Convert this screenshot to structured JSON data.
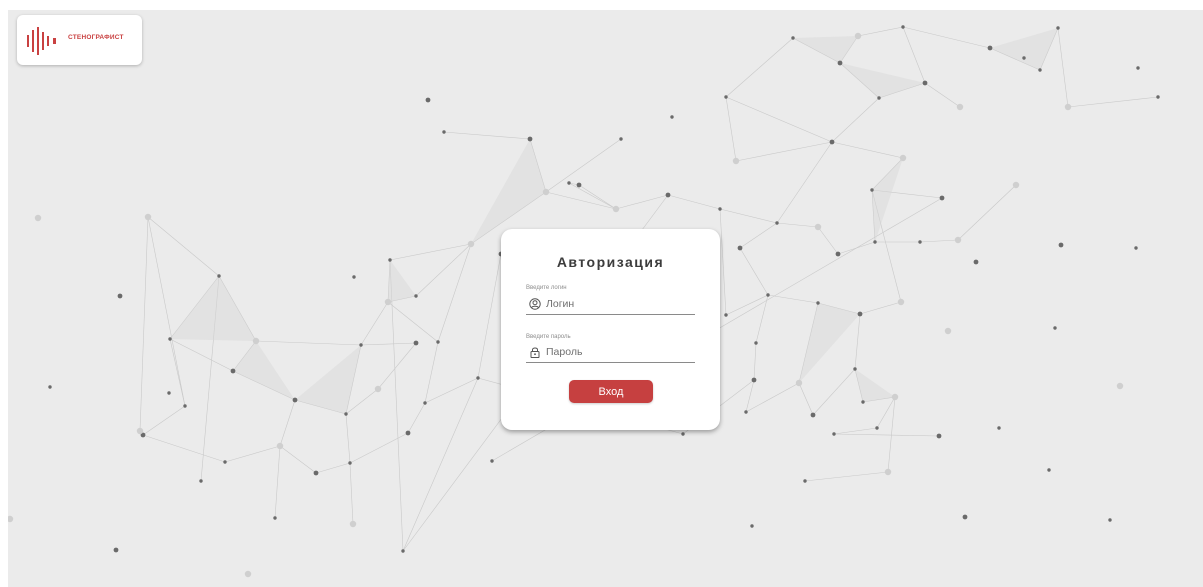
{
  "logo": {
    "text": "СТЕНОГРАФИСТ",
    "color": "#c94141"
  },
  "auth": {
    "title": "Авторизация",
    "login_label": "Введите логин",
    "login_placeholder": "Логин",
    "login_icon": "user-circle-icon",
    "password_label": "Введите пароль",
    "password_placeholder": "Пароль",
    "password_icon": "lock-icon",
    "submit_label": "Вход",
    "submit_color": "#c64040"
  },
  "background": {
    "color": "#ebebeb",
    "decoration": "network-graph"
  }
}
